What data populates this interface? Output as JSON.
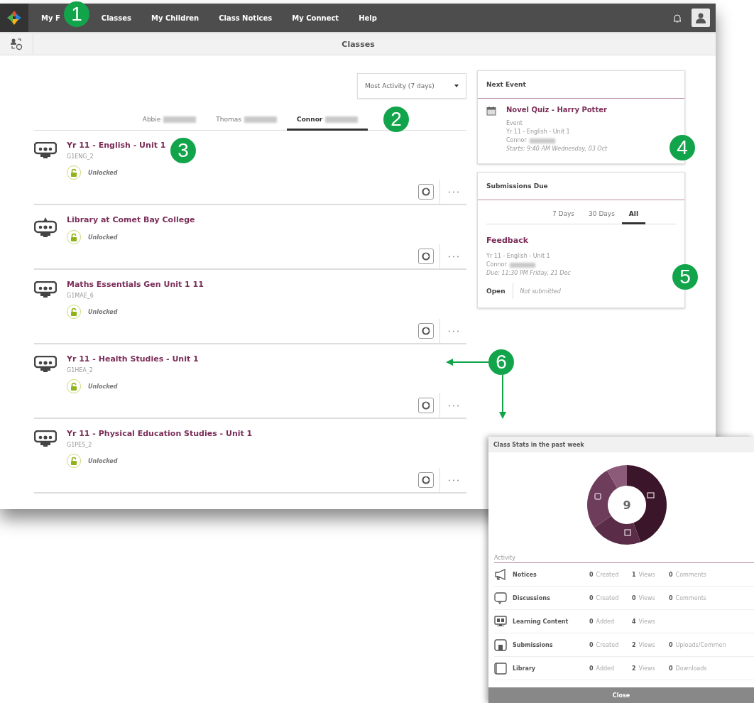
{
  "nav": {
    "items": [
      "My F",
      "Classes",
      "My Children",
      "Class Notices",
      "My Connect",
      "Help"
    ]
  },
  "subheader": {
    "title": "Classes"
  },
  "sort": {
    "value": "Most Activity (7 days)"
  },
  "children_tabs": [
    {
      "label": "Abbie",
      "selected": false
    },
    {
      "label": "Thomas",
      "selected": false
    },
    {
      "label": "Connor",
      "selected": true
    }
  ],
  "classes": [
    {
      "kind": "class",
      "title": "Yr 11 - English - Unit 1",
      "code": "G1ENG_2",
      "status": "Unlocked",
      "locked": false
    },
    {
      "kind": "library",
      "title": "Library at Comet Bay College",
      "status": "Unlocked",
      "locked": false
    },
    {
      "kind": "class",
      "title": "Maths Essentials Gen Unit 1 11",
      "code": "G1MAE_6",
      "status": "Unlocked",
      "locked": false
    },
    {
      "kind": "class",
      "title": "Yr 11 - Health Studies - Unit 1",
      "code": "G1HEA_2",
      "status": "Unlocked",
      "locked": false
    },
    {
      "kind": "class",
      "title": "Yr 11 - Physical Education Studies - Unit 1",
      "code": "G1PES_2",
      "status": "Unlocked",
      "locked": false
    }
  ],
  "next_event": {
    "heading": "Next Event",
    "title": "Novel Quiz - Harry Potter",
    "type": "Event",
    "class": "Yr 11 - English - Unit 1",
    "student": "Connor",
    "starts": "Starts: 9:40 AM Wednesday, 03 Oct"
  },
  "submissions": {
    "heading": "Submissions Due",
    "tabs": [
      {
        "label": "7 Days",
        "selected": false
      },
      {
        "label": "30 Days",
        "selected": false
      },
      {
        "label": "All",
        "selected": true
      }
    ],
    "item": {
      "title": "Feedback",
      "class": "Yr 11 - English - Unit 1",
      "student": "Connor",
      "due": "Due: 11:30 PM Friday, 21 Dec",
      "status": "Open",
      "note": "Not submitted"
    }
  },
  "stats_popup": {
    "title": "Class Stats in the past week",
    "total": "9",
    "section": "Activity",
    "rows": [
      {
        "kind": "notices",
        "name": "Notices",
        "stats": [
          {
            "value": "0",
            "label": "Created"
          },
          {
            "value": "1",
            "label": "Views"
          },
          {
            "value": "0",
            "label": "Comments"
          }
        ]
      },
      {
        "kind": "discussions",
        "name": "Discussions",
        "stats": [
          {
            "value": "0",
            "label": "Created"
          },
          {
            "value": "0",
            "label": "Views"
          },
          {
            "value": "0",
            "label": "Comments"
          }
        ]
      },
      {
        "kind": "content",
        "name": "Learning Content",
        "stats": [
          {
            "value": "0",
            "label": "Added"
          },
          {
            "value": "4",
            "label": "Views"
          }
        ]
      },
      {
        "kind": "submissions",
        "name": "Submissions",
        "stats": [
          {
            "value": "0",
            "label": "Created"
          },
          {
            "value": "2",
            "label": "Views"
          },
          {
            "value": "0",
            "label": "Uploads/Commen"
          }
        ]
      },
      {
        "kind": "library",
        "name": "Library",
        "stats": [
          {
            "value": "0",
            "label": "Added"
          },
          {
            "value": "2",
            "label": "Views"
          },
          {
            "value": "0",
            "label": "Downloads"
          }
        ]
      }
    ],
    "close": "Close"
  },
  "callouts": [
    "1",
    "2",
    "3",
    "4",
    "5",
    "6"
  ]
}
